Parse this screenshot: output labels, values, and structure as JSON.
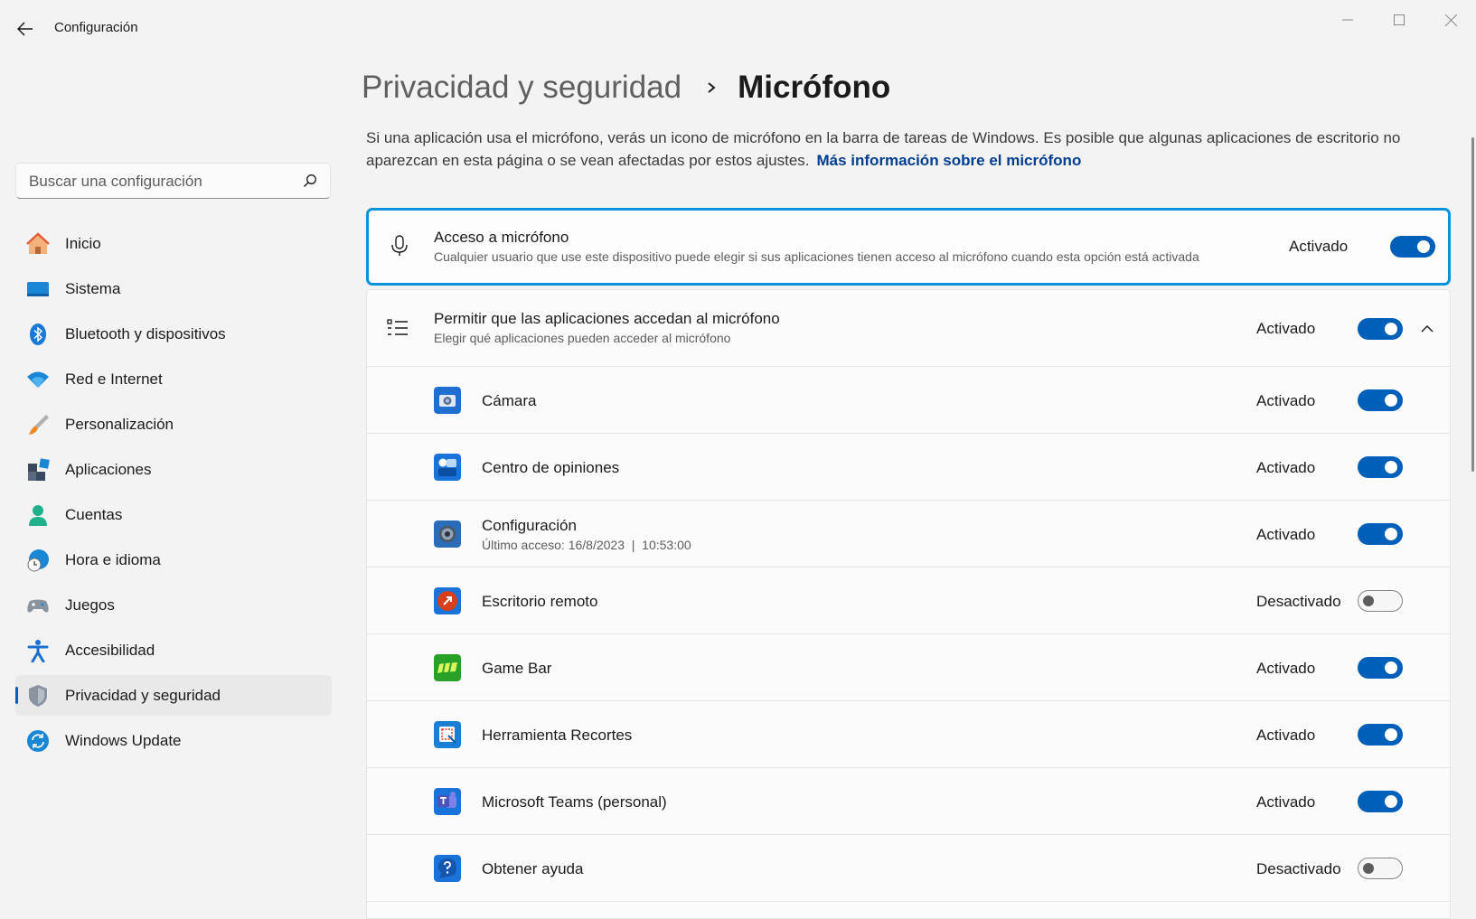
{
  "window": {
    "title": "Configuración",
    "controls": [
      "minimize-icon",
      "maximize-icon",
      "close-icon"
    ]
  },
  "sidebar": {
    "search_placeholder": "Buscar una configuración",
    "items": [
      {
        "label": "Inicio",
        "icon": "home-icon"
      },
      {
        "label": "Sistema",
        "icon": "system-icon"
      },
      {
        "label": "Bluetooth y dispositivos",
        "icon": "bluetooth-icon"
      },
      {
        "label": "Red e Internet",
        "icon": "wifi-icon"
      },
      {
        "label": "Personalización",
        "icon": "brush-icon"
      },
      {
        "label": "Aplicaciones",
        "icon": "apps-icon"
      },
      {
        "label": "Cuentas",
        "icon": "person-icon"
      },
      {
        "label": "Hora e idioma",
        "icon": "globe-clock-icon"
      },
      {
        "label": "Juegos",
        "icon": "gamepad-icon"
      },
      {
        "label": "Accesibilidad",
        "icon": "accessibility-icon"
      },
      {
        "label": "Privacidad y seguridad",
        "icon": "shield-icon",
        "selected": true
      },
      {
        "label": "Windows Update",
        "icon": "update-icon"
      }
    ]
  },
  "header": {
    "parent": "Privacidad y seguridad",
    "current": "Micrófono"
  },
  "intro": {
    "text": "Si una aplicación usa el micrófono, verás un icono de micrófono en la barra de tareas de Windows. Es posible que algunas aplicaciones de escritorio no aparezcan en esta página o se vean afectadas por estos ajustes.",
    "link": "Más información sobre el micrófono"
  },
  "master": {
    "title": "Acceso a micrófono",
    "subtitle": "Cualquier usuario que use este dispositivo puede elegir si sus aplicaciones tienen acceso al micrófono cuando esta opción está activada",
    "status": "Activado",
    "on": true,
    "icon": "microphone-icon"
  },
  "apps_section": {
    "title": "Permitir que las aplicaciones accedan al micrófono",
    "subtitle": "Elegir qué aplicaciones pueden acceder al micrófono",
    "status": "Activado",
    "on": true,
    "icon": "list-icon",
    "expanded": true
  },
  "apps": [
    {
      "name": "Cámara",
      "status": "Activado",
      "on": true,
      "icon": "camera-app-icon",
      "color": "#1f6fd1"
    },
    {
      "name": "Centro de opiniones",
      "status": "Activado",
      "on": true,
      "icon": "feedback-hub-icon",
      "color": "#1a73d9"
    },
    {
      "name": "Configuración",
      "detail": "Último acceso: 16/8/2023  |  10:53:00",
      "status": "Activado",
      "on": true,
      "icon": "settings-app-icon",
      "color": "#2b6cb8"
    },
    {
      "name": "Escritorio remoto",
      "status": "Desactivado",
      "on": false,
      "icon": "remote-desktop-icon",
      "color": "#d93f1a"
    },
    {
      "name": "Game Bar",
      "status": "Activado",
      "on": true,
      "icon": "game-bar-icon",
      "color": "#27a127"
    },
    {
      "name": "Herramienta Recortes",
      "status": "Activado",
      "on": true,
      "icon": "snipping-tool-icon",
      "color": "#1c7fd6"
    },
    {
      "name": "Microsoft Teams (personal)",
      "status": "Activado",
      "on": true,
      "icon": "teams-icon",
      "color": "#4b53bc"
    },
    {
      "name": "Obtener ayuda",
      "status": "Desactivado",
      "on": false,
      "icon": "get-help-icon",
      "color": "#1a73d9"
    }
  ],
  "colors": {
    "accent": "#005fb8",
    "focus_border": "#0a93d8",
    "link": "#003e92"
  }
}
